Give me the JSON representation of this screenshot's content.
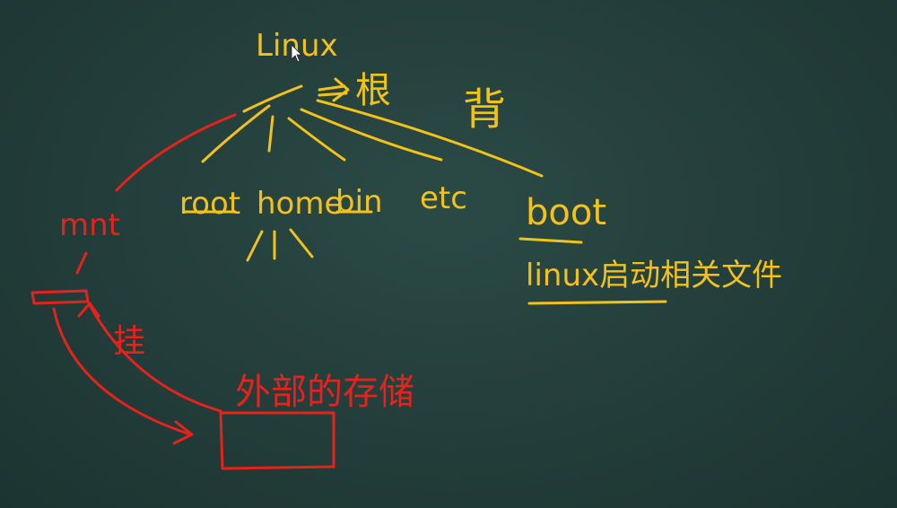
{
  "title": "Linux",
  "root_arrow_label": "根",
  "side_note": "背",
  "nodes": {
    "root_dir": "root",
    "home": "home",
    "bin": "bin",
    "etc": "etc",
    "boot": "boot",
    "mnt": "mnt"
  },
  "boot_note": "linux启动相关文件",
  "mount_label": "挂",
  "external_storage": "外部的存储",
  "colors": {
    "board": "#24403d",
    "chalk_yellow": "#f2c21b",
    "chalk_red": "#e5221b"
  }
}
